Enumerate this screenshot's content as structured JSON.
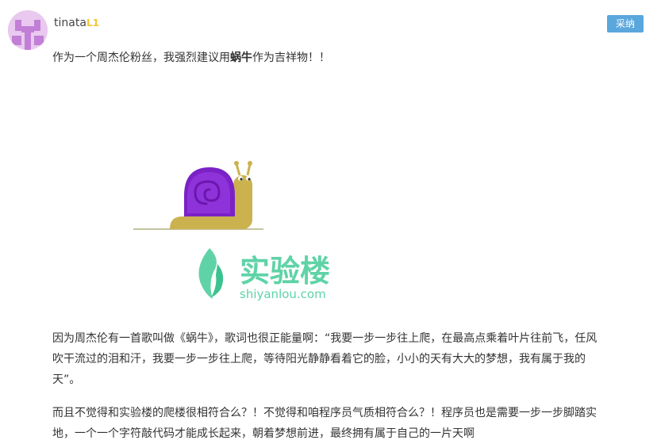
{
  "post": {
    "author": {
      "name": "tinata",
      "level": "L1"
    },
    "actions": {
      "adopt_label": "采纳"
    },
    "intro": {
      "before": "作为一个周杰伦粉丝，我强烈建议用",
      "bold": "蜗牛",
      "after": "作为吉祥物！！"
    },
    "image": {
      "logo_cn": "实验楼",
      "logo_url": "shiyanlou.com"
    },
    "paragraph1": {
      "line1": "因为周杰伦有一首歌叫做《蜗牛》，歌词也很正能量啊：“我要一步一步往上爬，在最高点乘着叶片往前飞，任风",
      "line2": "吹干流过的泪和汗，我要一步一步往上爬，等待阳光静静看着它的脸，小小的天有大大的梦想，我有属于我的",
      "line3": "天”。"
    },
    "paragraph2": {
      "line1": "而且不觉得和实验楼的爬楼很相符合么？！不觉得和咱程序员气质相符合么？！程序员也是需要一步一步脚踏实",
      "line2": "地，一个一个字符敲代码才能成长起来，朝着梦想前进，最终拥有属于自己的一片天啊"
    }
  },
  "colors": {
    "adopt_button": "#5aa7dd",
    "level_badge": "#f4c430",
    "snail_shell": "#8a2bd6",
    "snail_body": "#cbb24e",
    "logo_green": "#5fd3a7"
  }
}
